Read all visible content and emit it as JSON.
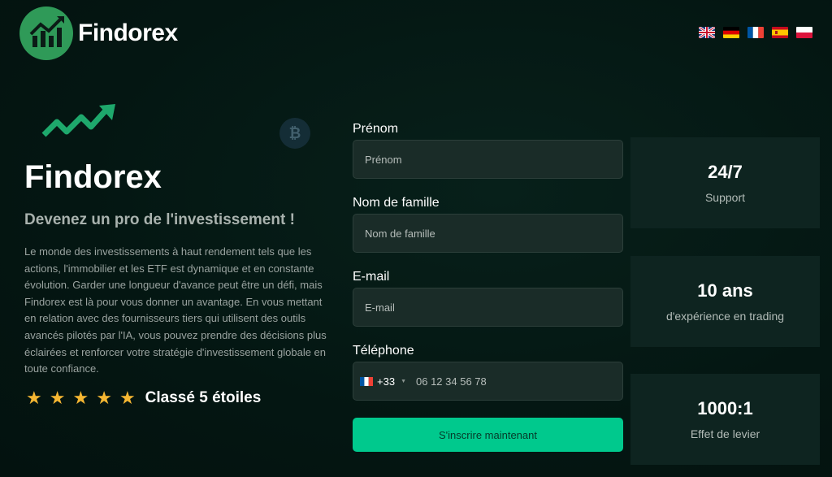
{
  "brand": {
    "name": "Findorex"
  },
  "languages": [
    {
      "code": "en",
      "icon": "uk-flag-icon"
    },
    {
      "code": "de",
      "icon": "germany-flag-icon"
    },
    {
      "code": "fr",
      "icon": "france-flag-icon"
    },
    {
      "code": "es",
      "icon": "spain-flag-icon"
    },
    {
      "code": "pl",
      "icon": "poland-flag-icon"
    }
  ],
  "hero": {
    "title": "Findorex",
    "subtitle": "Devenez un pro de l'investissement !",
    "description": "Le monde des investissements à haut rendement tels que les actions, l'immobilier et les ETF est dynamique et en constante évolution. Garder une longueur d'avance peut être un défi, mais Findorex est là pour vous donner un avantage. En vous mettant en relation avec des fournisseurs tiers qui utilisent des outils avancés pilotés par l'IA, vous pouvez prendre des décisions plus éclairées et renforcer votre stratégie d'investissement globale en toute confiance.",
    "rating": {
      "stars": 5,
      "label": "Classé 5 étoiles"
    }
  },
  "form": {
    "first_name": {
      "label": "Prénom",
      "placeholder": "Prénom",
      "value": ""
    },
    "last_name": {
      "label": "Nom de famille",
      "placeholder": "Nom de famille",
      "value": ""
    },
    "email": {
      "label": "E-mail",
      "placeholder": "E-mail",
      "value": ""
    },
    "phone": {
      "label": "Téléphone",
      "country_code": "+33",
      "placeholder": "06 12 34 56 78",
      "value": ""
    },
    "submit_label": "S'inscrire maintenant"
  },
  "stats": [
    {
      "value": "24/7",
      "label": "Support"
    },
    {
      "value": "10 ans",
      "label": "d'expérience en trading"
    },
    {
      "value": "1000:1",
      "label": "Effet de levier"
    }
  ],
  "colors": {
    "background": "#041612",
    "brand_green": "#2f9a58",
    "accent": "#00c98d",
    "star": "#f5b632"
  }
}
